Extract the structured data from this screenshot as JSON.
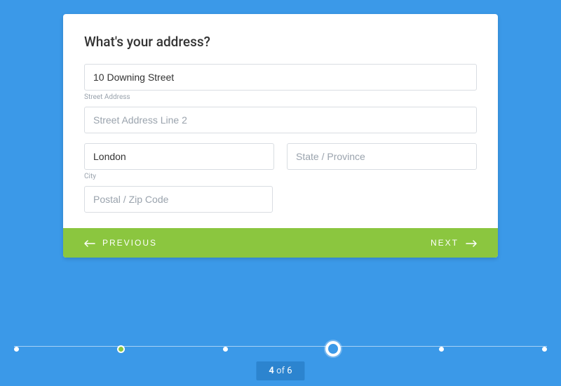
{
  "form": {
    "title": "What's your address?",
    "street": {
      "value": "10 Downing Street",
      "label": "Street Address"
    },
    "street2": {
      "placeholder": "Street Address Line 2"
    },
    "city": {
      "value": "London",
      "label": "City"
    },
    "state": {
      "placeholder": "State / Province"
    },
    "postal": {
      "placeholder": "Postal / Zip Code"
    }
  },
  "nav": {
    "previous": "PREVIOUS",
    "next": "NEXT"
  },
  "progress": {
    "current": "4",
    "of": " of ",
    "total": "6"
  }
}
